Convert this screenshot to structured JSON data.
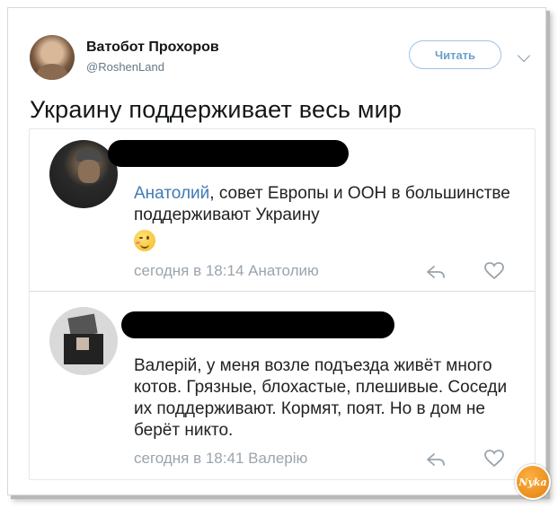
{
  "tweet": {
    "author_name": "Ватобот Прохоров",
    "author_handle": "@RoshenLand",
    "follow_label": "Читать",
    "text": "Украину поддерживает весь мир"
  },
  "comments": [
    {
      "mention": "Анатолий",
      "text": ", совет Европы и ООН в большинстве поддерживают Украину",
      "emoji": "winking-face",
      "meta": "сегодня в 18:14 Анатолию"
    },
    {
      "text": "Валерій, у меня возле подъезда живёт много котов. Грязные, блохастые, плешивые. Соседи их поддерживают. Кормят, поят. Но в дом не берёт никто.",
      "meta": "сегодня в 18:41 Валерію"
    }
  ],
  "watermark": "Nyka",
  "colors": {
    "mention": "#3f7bb3",
    "follow_border": "#9bc3e6",
    "meta": "#9aa4ad"
  }
}
